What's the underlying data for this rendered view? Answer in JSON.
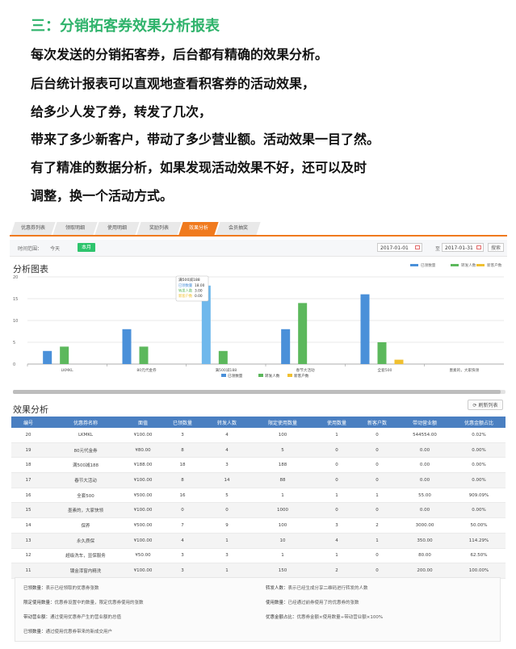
{
  "intro": {
    "heading": "三：分销拓客券效果分析报表",
    "lines": [
      "每次发送的分销拓客券，后台都有精确的效果分析。",
      "后台统计报表可以直观地查看积客券的活动效果，",
      "给多少人发了券，转发了几次，",
      "带来了多少新客户，带动了多少营业额。活动效果一目了然。",
      "有了精准的数据分析，如果发现活动效果不好，还可以及时",
      "调整，换一个活动方式。"
    ]
  },
  "tabs": [
    "优惠券列表",
    "领取明细",
    "使用明细",
    "奖励列表",
    "效果分析",
    "会员抽奖"
  ],
  "active_tab": 4,
  "filter": {
    "label": "时间范围：",
    "option_today": "今天",
    "option_month": "本月",
    "date_from": "2017-01-01",
    "date_to": "2017-01-31",
    "to_text": "至",
    "search": "搜索"
  },
  "chart_title": "分析图表",
  "chart_data": {
    "type": "bar",
    "categories": [
      "LKMKL",
      "80元代金券",
      "满500减188",
      "春节大活动",
      "全套500",
      "墨素的，大家快领"
    ],
    "series": [
      {
        "name": "已领数量",
        "color": "#4a90d9",
        "values": [
          3,
          8,
          18,
          8,
          16,
          0
        ]
      },
      {
        "name": "转发人数",
        "color": "#5cb85c",
        "values": [
          4,
          4,
          3,
          14,
          5,
          0
        ]
      },
      {
        "name": "新客户数",
        "color": "#f0c030",
        "values": [
          0,
          0,
          0,
          0,
          1,
          0
        ]
      }
    ],
    "ylim": [
      0,
      20
    ],
    "yticks": [
      0,
      5,
      10,
      15,
      20
    ],
    "legend_placement": "top-right",
    "tooltip": {
      "title": "满500减188",
      "rows": [
        {
          "label": "已领数量",
          "value": "18.00"
        },
        {
          "label": "转发人数",
          "value": "3.00"
        },
        {
          "label": "新客户数",
          "value": "0.00"
        }
      ]
    }
  },
  "table_title": "效果分析",
  "refresh_label": "刷新列表",
  "table": {
    "headers": [
      "编号",
      "优惠券名称",
      "面值",
      "已领数量",
      "转发人数",
      "限定使用数量",
      "使用数量",
      "新客户数",
      "带动营业额",
      "优惠金额占比"
    ],
    "rows": [
      [
        "20",
        "LKMKL",
        "¥100.00",
        "3",
        "4",
        "100",
        "1",
        "0",
        "544554.00",
        "0.02%"
      ],
      [
        "19",
        "80元代金券",
        "¥80.00",
        "8",
        "4",
        "5",
        "0",
        "0",
        "0.00",
        "0.00%"
      ],
      [
        "18",
        "满500减188",
        "¥188.00",
        "18",
        "3",
        "188",
        "0",
        "0",
        "0.00",
        "0.00%"
      ],
      [
        "17",
        "春节大活动",
        "¥100.00",
        "8",
        "14",
        "88",
        "0",
        "0",
        "0.00",
        "0.00%"
      ],
      [
        "16",
        "全套500",
        "¥500.00",
        "16",
        "5",
        "1",
        "1",
        "1",
        "55.00",
        "909.09%"
      ],
      [
        "15",
        "墨素的，大家快领",
        "¥100.00",
        "0",
        "0",
        "1000",
        "0",
        "0",
        "0.00",
        "0.00%"
      ],
      [
        "14",
        "保养",
        "¥500.00",
        "7",
        "9",
        "100",
        "3",
        "2",
        "3000.00",
        "50.00%"
      ],
      [
        "13",
        "永久质保",
        "¥100.00",
        "4",
        "1",
        "10",
        "4",
        "1",
        "350.00",
        "114.29%"
      ],
      [
        "12",
        "超级洗车，显保服务",
        "¥50.00",
        "3",
        "3",
        "1",
        "1",
        "0",
        "80.00",
        "62.50%"
      ],
      [
        "11",
        "镀金漆窗内精洗",
        "¥100.00",
        "3",
        "1",
        "150",
        "2",
        "0",
        "200.00",
        "100.00%"
      ]
    ]
  },
  "notes": [
    {
      "term": "已领数量：",
      "text": "表示已经领取的优惠券张数"
    },
    {
      "term": "转发人数：",
      "text": "表示已经生成分享二维码进行转发的人数"
    },
    {
      "term": "限定使用数量：",
      "text": "优惠券设置中的数量，限定优惠券使用的张数"
    },
    {
      "term": "使用数量：",
      "text": "已经通过前券使用了的优惠券的张数"
    },
    {
      "term": "带动营业额：",
      "text": "通过使用优惠券产生的营业额的总值"
    },
    {
      "term": "优惠金额占比：",
      "text": "优惠券金额×使用数量÷带动营业额×100%"
    },
    {
      "term": "已领数量：",
      "text": "通过使用优惠券带来的新成交用户"
    }
  ]
}
